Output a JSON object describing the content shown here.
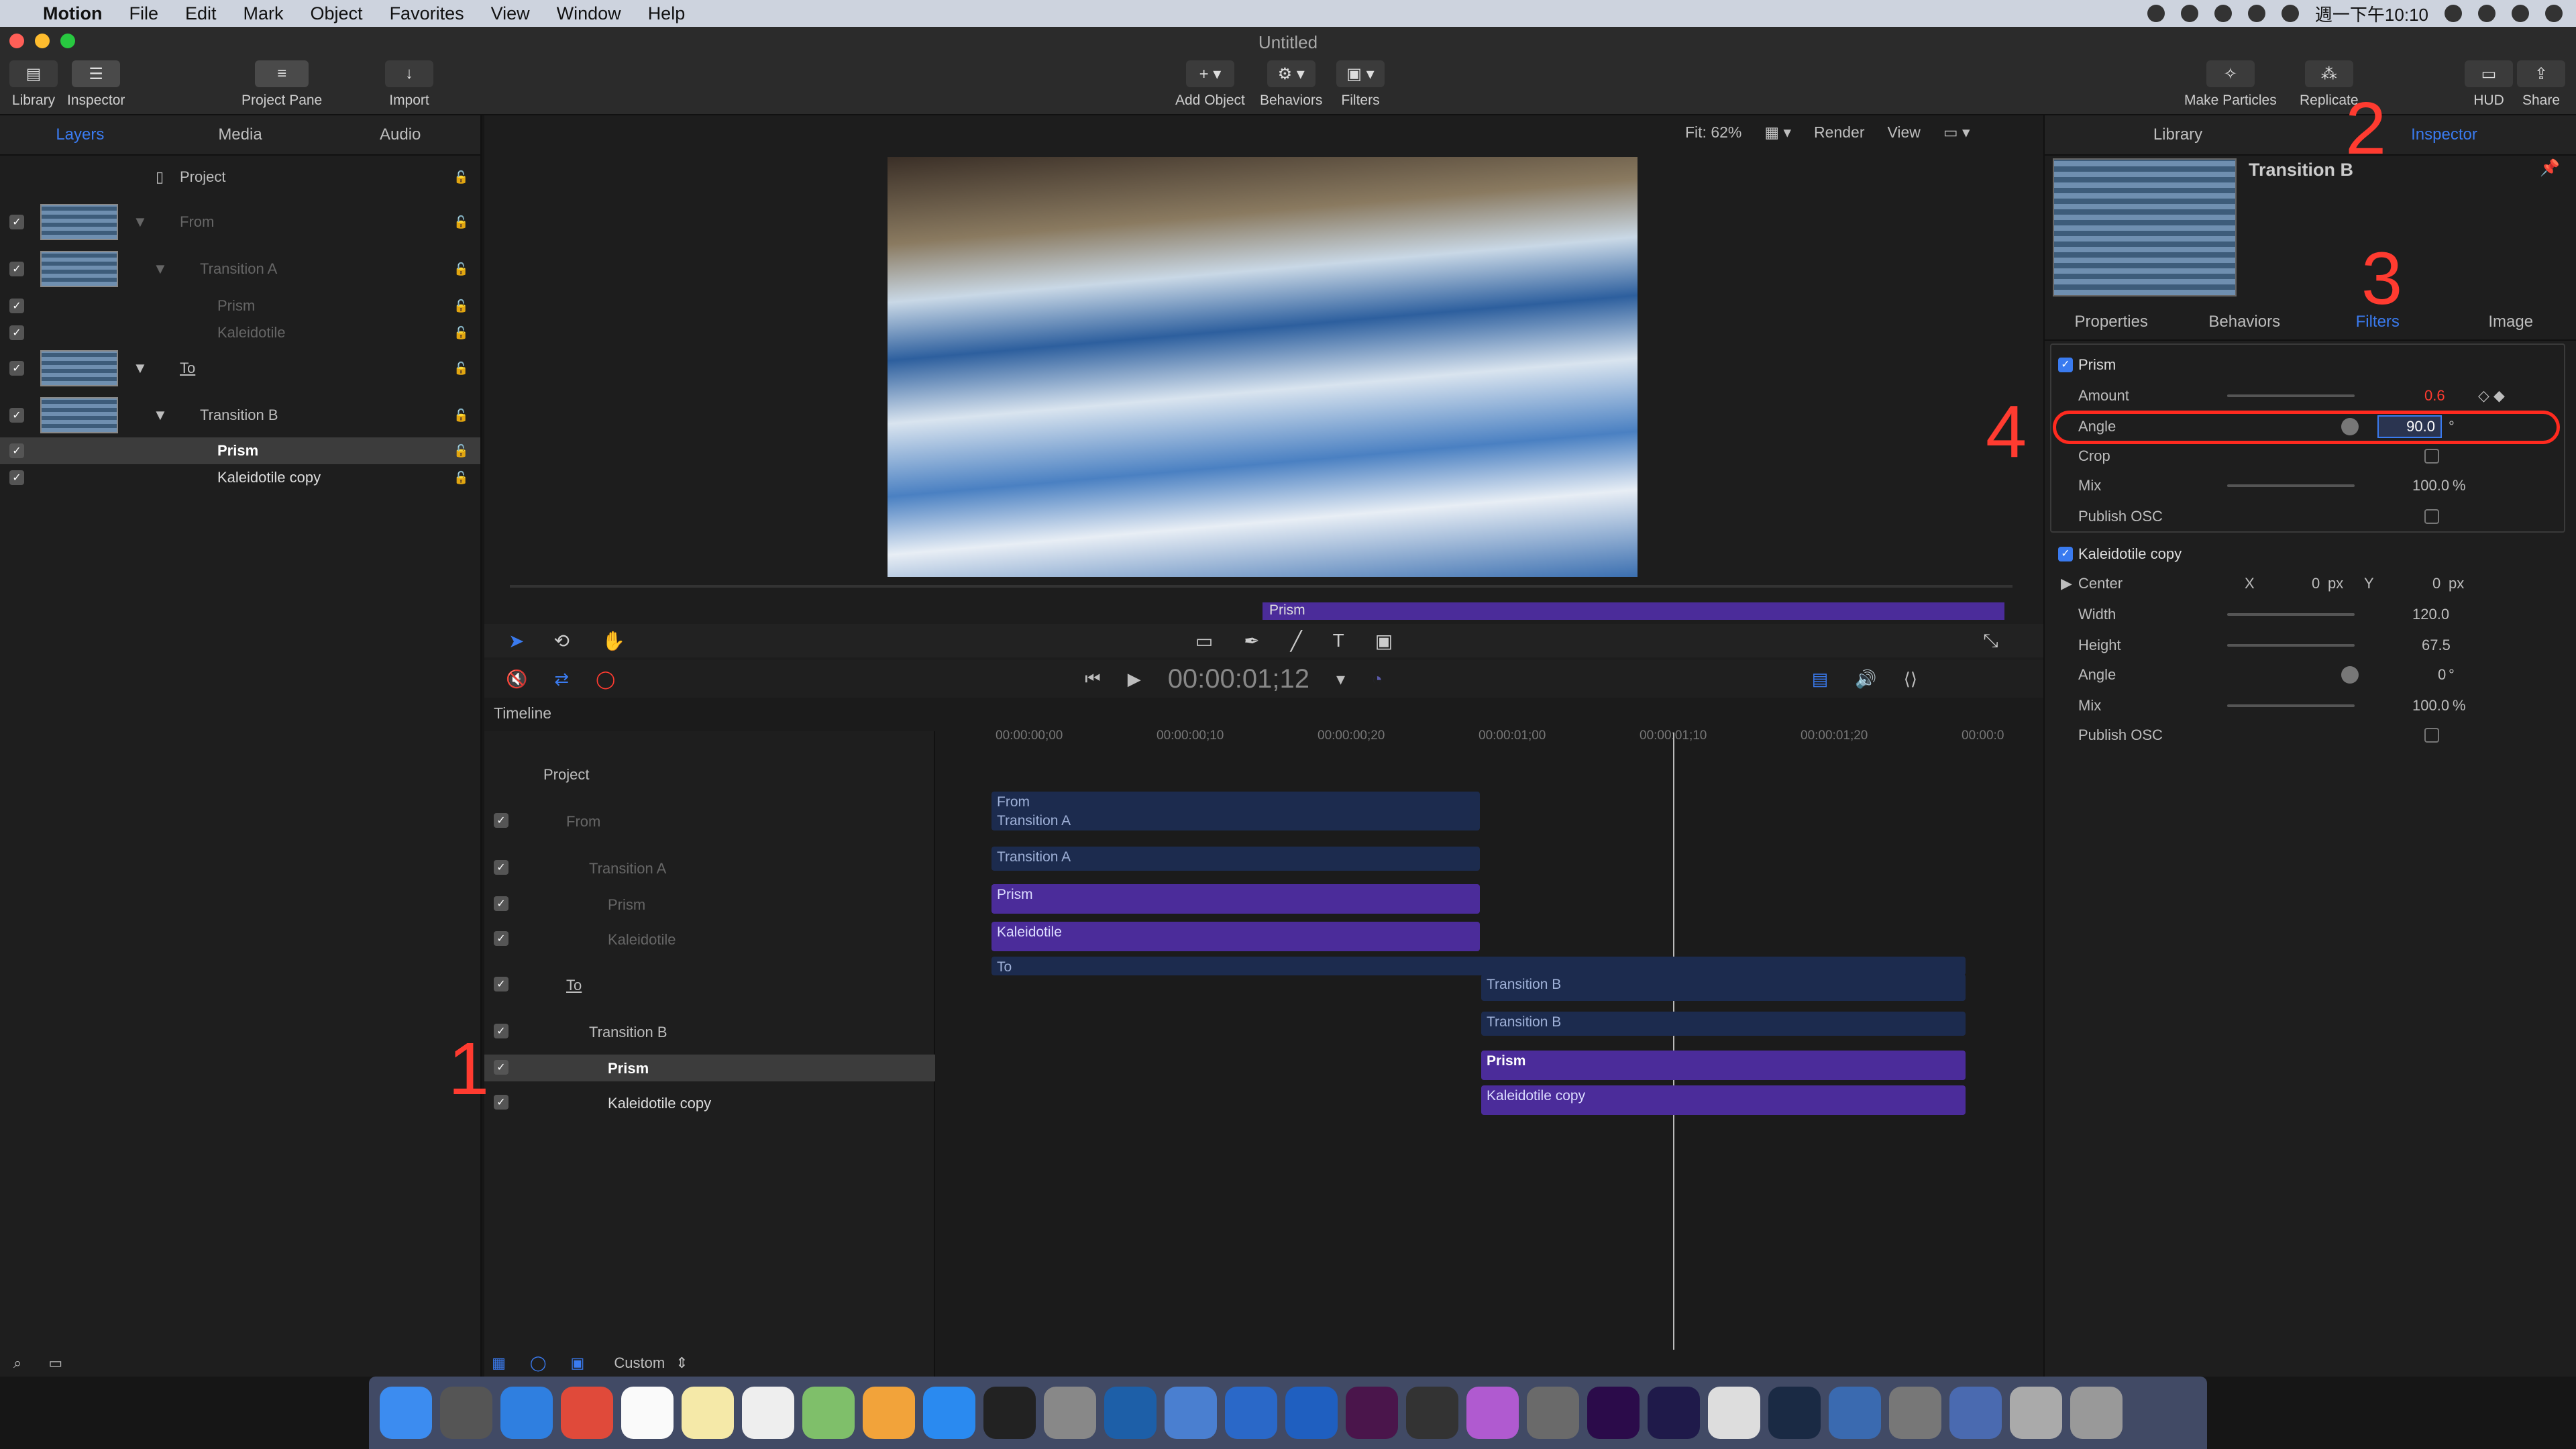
{
  "menubar": {
    "app": "Motion",
    "items": [
      "File",
      "Edit",
      "Mark",
      "Object",
      "Favorites",
      "View",
      "Window",
      "Help"
    ],
    "clock": "週一下午10:10"
  },
  "window": {
    "title": "Untitled"
  },
  "toolbar": {
    "library": "Library",
    "inspector": "Inspector",
    "project_pane": "Project Pane",
    "import": "Import",
    "add_object": "Add Object",
    "behaviors": "Behaviors",
    "filters": "Filters",
    "make_particles": "Make Particles",
    "replicate": "Replicate",
    "hud": "HUD",
    "share": "Share"
  },
  "left_tabs": [
    "Layers",
    "Media",
    "Audio"
  ],
  "layers": [
    {
      "name": "Project"
    },
    {
      "name": "From"
    },
    {
      "name": "Transition A"
    },
    {
      "name": "Prism"
    },
    {
      "name": "Kaleidotile"
    },
    {
      "name": "To"
    },
    {
      "name": "Transition B"
    },
    {
      "name": "Prism"
    },
    {
      "name": "Kaleidotile copy"
    }
  ],
  "viewer": {
    "fit": "Fit: 62%",
    "render": "Render",
    "view": "View",
    "bar_label": "Prism"
  },
  "transport": {
    "timecode": "00:00:01;12"
  },
  "timeline": {
    "label": "Timeline",
    "ruler": [
      "00:00:00;00",
      "00:00:00;10",
      "00:00:00;20",
      "00:00:01;00",
      "00:00:01;10",
      "00:00:01;20",
      "00:00:0"
    ],
    "rows": [
      "Project",
      "From",
      "Transition A",
      "Prism",
      "Kaleidotile",
      "To",
      "Transition B",
      "Prism",
      "Kaleidotile copy"
    ],
    "clips": {
      "from": "From",
      "transA1": "Transition A",
      "transA2": "Transition A",
      "prism1": "Prism",
      "kal1": "Kaleidotile",
      "to": "To",
      "transB1": "Transition B",
      "transB2": "Transition B",
      "prism2": "Prism",
      "kal2": "Kaleidotile copy"
    },
    "zoom_preset": "Custom"
  },
  "inspector": {
    "tabs": [
      "Library",
      "Inspector"
    ],
    "title": "Transition B",
    "subtabs": [
      "Properties",
      "Behaviors",
      "Filters",
      "Image"
    ],
    "prism": {
      "name": "Prism",
      "amount_label": "Amount",
      "amount": "0.6",
      "angle_label": "Angle",
      "angle": "90.0",
      "angle_unit": "°",
      "crop_label": "Crop",
      "mix_label": "Mix",
      "mix": "100.0",
      "mix_unit": "%",
      "publish_label": "Publish OSC"
    },
    "kal": {
      "name": "Kaleidotile copy",
      "center_label": "Center",
      "x_label": "X",
      "x": "0",
      "x_unit": "px",
      "y_label": "Y",
      "y": "0",
      "y_unit": "px",
      "width_label": "Width",
      "width": "120.0",
      "height_label": "Height",
      "height": "67.5",
      "angle_label": "Angle",
      "angle": "0",
      "angle_unit": "°",
      "mix_label": "Mix",
      "mix": "100.0",
      "mix_unit": "%",
      "publish_label": "Publish OSC"
    }
  },
  "annotations": [
    "1",
    "2",
    "3",
    "4"
  ],
  "colors": {
    "accent": "#3a7bf0",
    "clip_purple": "#4b2c9a",
    "annotation": "#ff3b30"
  }
}
